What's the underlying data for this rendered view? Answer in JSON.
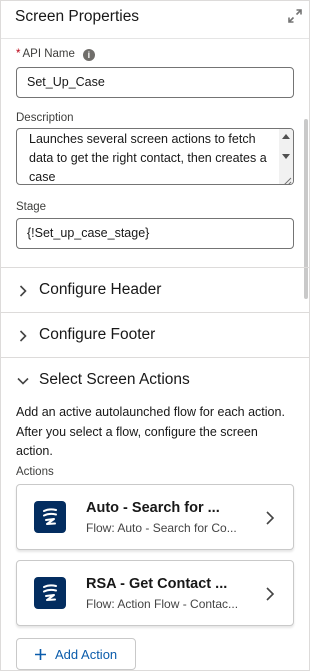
{
  "panel": {
    "title": "Screen Properties",
    "expand_icon": "expand-icon"
  },
  "api_name": {
    "required_marker": "*",
    "label": "API Name",
    "info_icon": "info-icon",
    "value": "Set_Up_Case"
  },
  "description": {
    "label": "Description",
    "value": "Launches several screen actions to fetch data to get the right contact, then creates a case"
  },
  "stage": {
    "label": "Stage",
    "value": "{!Set_up_case_stage}"
  },
  "sections": {
    "header": {
      "label": "Configure Header",
      "expanded": false
    },
    "footer": {
      "label": "Configure Footer",
      "expanded": false
    },
    "actions": {
      "label": "Select Screen Actions",
      "expanded": true
    }
  },
  "screen_actions": {
    "help_text": "Add an active autolaunched flow for each action. After you select a flow, configure the screen action.",
    "list_label": "Actions",
    "items": [
      {
        "title": "Auto - Search for ...",
        "subtitle": "Flow: Auto - Search for Co...",
        "icon": "flow-icon"
      },
      {
        "title": "RSA - Get Contact ...",
        "subtitle": "Flow: Action Flow - Contac...",
        "icon": "flow-icon"
      }
    ],
    "add_label": "Add Action"
  },
  "colors": {
    "accent": "#0b5cab",
    "icon_bg": "#032d60",
    "required": "#ba0517",
    "border": "#dddbda"
  }
}
